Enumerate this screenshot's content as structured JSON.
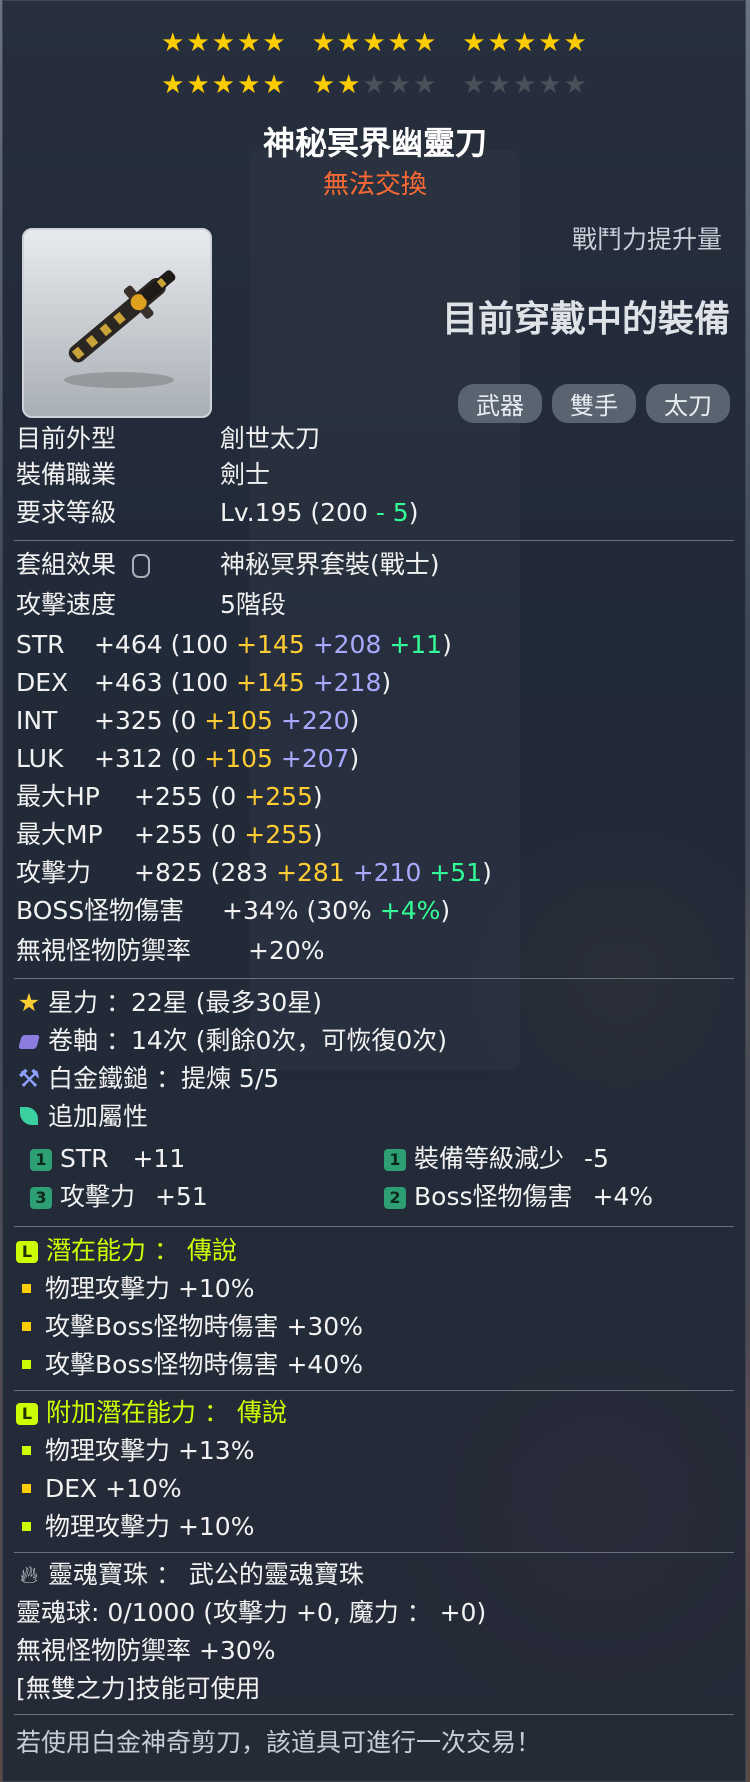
{
  "header": {
    "title": "神秘冥界幽靈刀",
    "trade_status": "無法交換"
  },
  "stars": {
    "filled": 22,
    "total": 30
  },
  "right_panel": {
    "power_label": "戰鬥力提升量",
    "equipped_label": "目前穿戴中的裝備",
    "tags": [
      "武器",
      "雙手",
      "太刀"
    ]
  },
  "info": [
    {
      "label": "目前外型",
      "value": "創世太刀"
    },
    {
      "label": "裝備職業",
      "value": "劍士"
    },
    {
      "label": "要求等級",
      "value_main": "Lv.195 (200 ",
      "value_minus": "- 5",
      "value_end": ")"
    }
  ],
  "set": {
    "label": "套組效果",
    "value": "神秘冥界套裝(戰士)"
  },
  "attack_speed": {
    "label": "攻擊速度",
    "value": "5階段"
  },
  "stats": [
    {
      "label": "STR",
      "total": "+464",
      "base": "(100",
      "a": "+145",
      "b": "+208",
      "c": "+11",
      "end": ")"
    },
    {
      "label": "DEX",
      "total": "+463",
      "base": "(100",
      "a": "+145",
      "b": "+218",
      "c": "",
      "end": ")"
    },
    {
      "label": "INT",
      "total": "+325",
      "base": "(0",
      "a": "+105",
      "b": "+220",
      "c": "",
      "end": ")"
    },
    {
      "label": "LUK",
      "total": "+312",
      "base": "(0",
      "a": "+105",
      "b": "+207",
      "c": "",
      "end": ")"
    },
    {
      "label": "最大HP",
      "total": "+255",
      "base": "(0",
      "a": "+255",
      "b": "",
      "c": "",
      "end": ")"
    },
    {
      "label": "最大MP",
      "total": "+255",
      "base": "(0",
      "a": "+255",
      "b": "",
      "c": "",
      "end": ")"
    },
    {
      "label": "攻擊力",
      "total": "+825",
      "base": "(283",
      "a": "+281",
      "b": "+210",
      "c": "+51",
      "end": ")"
    }
  ],
  "boss": {
    "label": "BOSS怪物傷害",
    "total": "+34%",
    "base": "(30%",
    "c": "+4%",
    "end": ")"
  },
  "ignore_def": {
    "label": "無視怪物防禦率",
    "value": "+20%"
  },
  "starforce": {
    "label": "星力",
    "value": "：22星 (最多30星)"
  },
  "scroll": {
    "label": "卷軸",
    "value": "：14次 (剩餘0次，可恢復0次)"
  },
  "platinum": {
    "label": "白金鐵鎚",
    "value": "：提煉 5/5"
  },
  "flame": {
    "label": "追加屬性",
    "items": [
      {
        "tier": "1",
        "label": "STR",
        "value": "+11"
      },
      {
        "tier": "1",
        "label": "裝備等級減少",
        "value": "-5"
      },
      {
        "tier": "3",
        "label": "攻擊力",
        "value": "+51"
      },
      {
        "tier": "2",
        "label": "Boss怪物傷害",
        "value": "+4%"
      }
    ]
  },
  "potential": {
    "badge": "L",
    "label": "潛在能力 ： 傳說",
    "lines": [
      "物理攻擊力 +10%",
      "攻擊Boss怪物時傷害 +30%",
      "攻擊Boss怪物時傷害 +40%"
    ]
  },
  "bonus_potential": {
    "badge": "L",
    "label": "附加潛在能力 ： 傳說",
    "lines": [
      "物理攻擊力 +13%",
      "DEX +10%",
      "物理攻擊力 +10%"
    ]
  },
  "soul": {
    "label": "靈魂寶珠 ： 武公的靈魂寶珠",
    "charge": "靈魂球: 0/1000 (攻擊力 +0, 魔力 ： +0)",
    "ignore": "無視怪物防禦率 +30%",
    "skill": "[無雙之力]技能可使用"
  },
  "footer": {
    "note": "若使用白金神奇剪刀，該道具可進行一次交易！"
  },
  "colors": {
    "stars_on": "#ffcc00",
    "stars_off": "#4a4f58",
    "untradeable": "#ff6a33",
    "scroll_bonus": "#ffcc33",
    "enhance_bonus": "#a9a9ff",
    "flame_bonus": "#33ff99",
    "legendary": "#ccff00"
  },
  "icons": {
    "item": "two-handed-katana-icon",
    "starforce": "star-icon",
    "scroll": "scroll-icon",
    "hammer": "hammer-icon",
    "flame": "leaf-icon",
    "soul": "flame-icon",
    "set": "lock-icon"
  }
}
